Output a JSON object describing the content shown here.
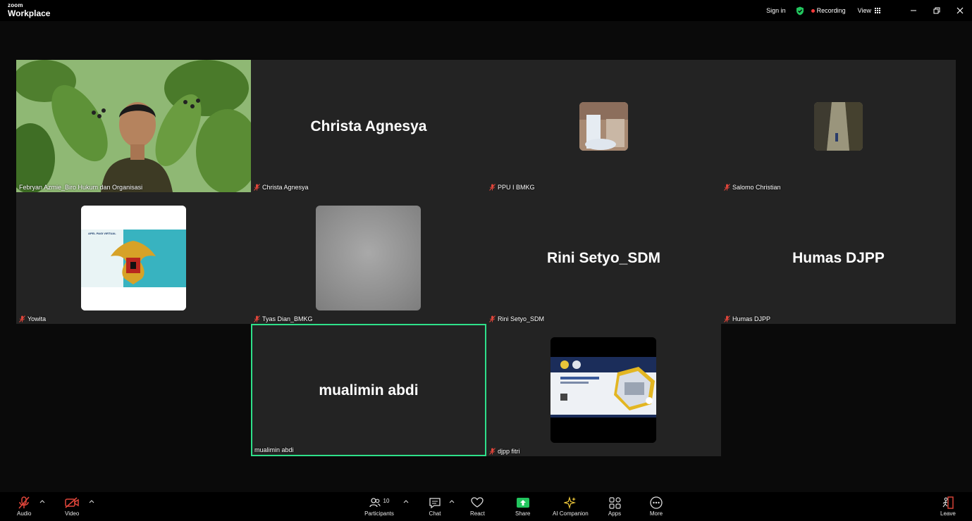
{
  "app": {
    "brand_small": "zoom",
    "brand_large": "Workplace"
  },
  "titlebar": {
    "sign_in": "Sign in",
    "recording": "Recording",
    "view": "View"
  },
  "tiles": [
    {
      "label": "Febryan Azmie_Biro Hukum dan Organisasi",
      "big_name": "",
      "muted": false
    },
    {
      "label": "Christa Agnesya",
      "big_name": "Christa Agnesya",
      "muted": true
    },
    {
      "label": "PPU I BMKG",
      "big_name": "",
      "muted": true
    },
    {
      "label": "Salomo Christian",
      "big_name": "",
      "muted": true
    },
    {
      "label": "Yowita",
      "big_name": "",
      "muted": true,
      "avatar_text": "APEL PAGI VIRTUAL"
    },
    {
      "label": "Tyas Dian_BMKG",
      "big_name": "",
      "muted": true
    },
    {
      "label": "Rini Setyo_SDM",
      "big_name": "Rini Setyo_SDM",
      "muted": true
    },
    {
      "label": "Humas DJPP",
      "big_name": "Humas DJPP",
      "muted": true
    },
    {
      "label": "mualimin abdi",
      "big_name": "mualimin abdi",
      "muted": false,
      "active_speaker": true
    },
    {
      "label": "djpp fitri",
      "big_name": "",
      "muted": true
    }
  ],
  "toolbar": {
    "audio": "Audio",
    "video": "Video",
    "participants": "Participants",
    "participants_count": "10",
    "chat": "Chat",
    "react": "React",
    "share": "Share",
    "ai_companion": "AI Companion",
    "apps": "Apps",
    "more": "More",
    "leave": "Leave"
  },
  "colors": {
    "active_speaker_border": "#2ee08a",
    "share_green": "#22c55e",
    "muted_red": "#e0453a",
    "tile_bg": "#232323"
  }
}
